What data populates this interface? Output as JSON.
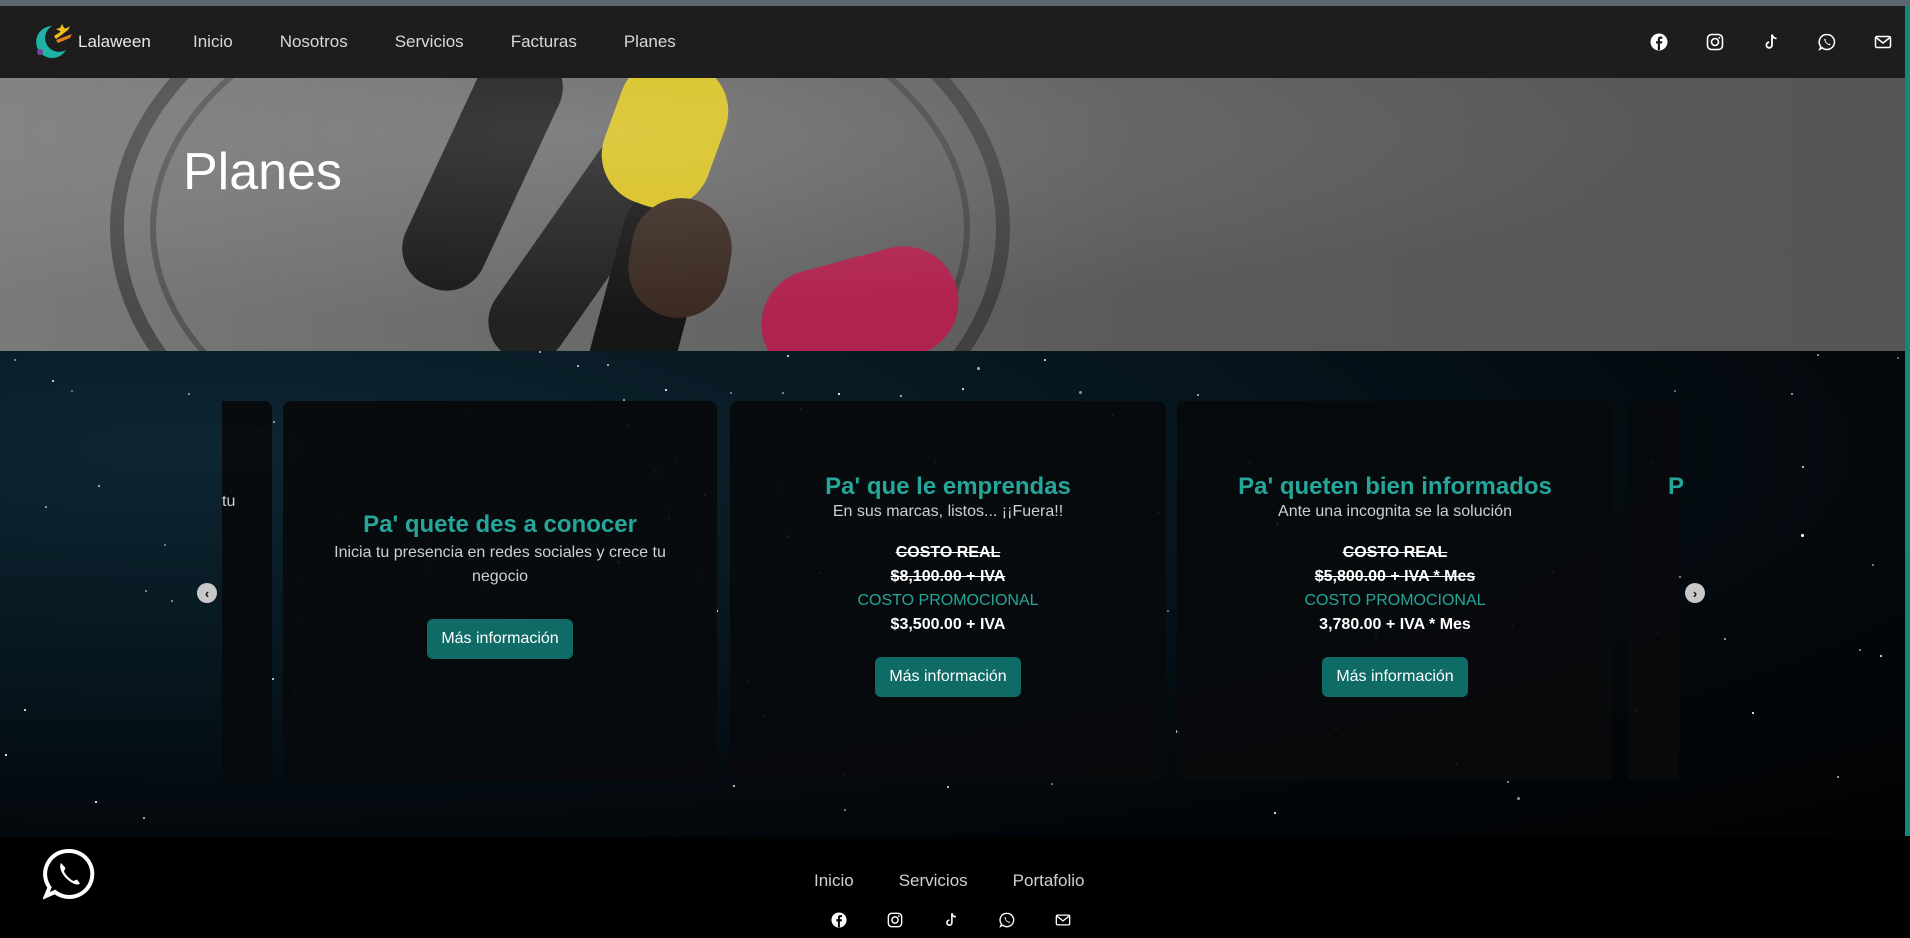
{
  "brand": {
    "name": "Lalaween"
  },
  "nav": {
    "links": [
      "Inicio",
      "Nosotros",
      "Servicios",
      "Facturas",
      "Planes"
    ],
    "social_icons": [
      "facebook-icon",
      "instagram-icon",
      "tiktok-icon",
      "whatsapp-icon",
      "mail-icon"
    ]
  },
  "hero": {
    "title": "Planes"
  },
  "plans": {
    "partial_left_text": "tu",
    "partial_right_text": "P",
    "cards": [
      {
        "title": "Pa' quete des a conocer",
        "subtitle": "Inicia tu presencia en redes sociales y crece tu negocio",
        "button": "Más información"
      },
      {
        "title": "Pa' que le emprendas",
        "subtitle": "En sus marcas, listos... ¡¡Fuera!!",
        "real_label": "COSTO REAL",
        "real_price": "$8,100.00 + IVA",
        "promo_label": "COSTO PROMOCIONAL",
        "promo_price": "$3,500.00 + IVA",
        "button": "Más información"
      },
      {
        "title": "Pa' queten bien informados",
        "subtitle": "Ante una incognita se la solución",
        "real_label": "COSTO REAL",
        "real_price": "$5,800.00 + IVA * Mes",
        "promo_label": "COSTO PROMOCIONAL",
        "promo_price": "3,780.00 + IVA * Mes",
        "button": "Más información"
      }
    ],
    "prev_arrow": "‹",
    "next_arrow": "›"
  },
  "footer": {
    "links": [
      "Inicio",
      "Servicios",
      "Portafolio"
    ]
  },
  "colors": {
    "accent": "#26a69a",
    "button": "#0f6b65",
    "navbar": "#1d1d1d"
  }
}
